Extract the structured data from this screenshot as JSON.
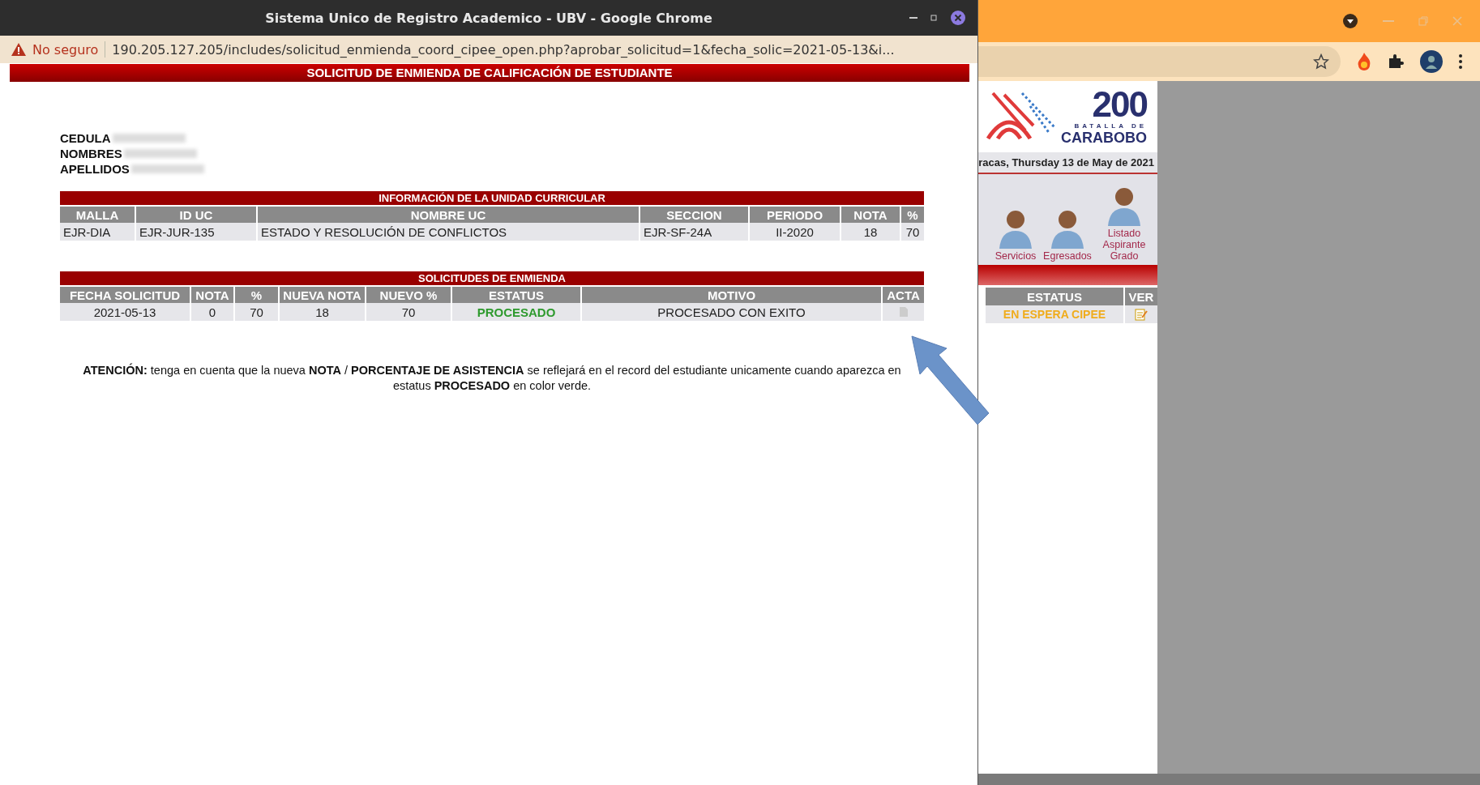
{
  "popup": {
    "title": "Sistema Unico de Registro Academico - UBV - Google Chrome",
    "security_label": "No seguro",
    "url": "190.205.127.205/includes/solicitud_enmienda_coord_cipee_open.php?aprobar_solicitud=1&fecha_solic=2021-05-13&i...",
    "page_title": "SOLICITUD DE ENMIENDA DE CALIFICACIÓN DE ESTUDIANTE"
  },
  "student": [
    {
      "label": "CEDULA"
    },
    {
      "label": "NOMBRES"
    },
    {
      "label": "APELLIDOS"
    }
  ],
  "course_table": {
    "title": "INFORMACIÓN DE LA UNIDAD CURRICULAR",
    "columns": [
      "MALLA",
      "ID UC",
      "NOMBRE UC",
      "SECCION",
      "PERIODO",
      "NOTA",
      "%"
    ],
    "rows": [
      [
        "EJR-DIA",
        "EJR-JUR-135",
        "ESTADO Y RESOLUCIÓN DE CONFLICTOS",
        "EJR-SF-24A",
        "II-2020",
        "18",
        "70"
      ]
    ]
  },
  "requests_table": {
    "title": "SOLICITUDES DE ENMIENDA",
    "columns": [
      "FECHA SOLICITUD",
      "NOTA",
      "%",
      "NUEVA NOTA",
      "NUEVO %",
      "ESTATUS",
      "MOTIVO",
      "ACTA"
    ],
    "rows": [
      {
        "fecha": "2021-05-13",
        "nota": "0",
        "porcentaje": "70",
        "nueva_nota": "18",
        "nuevo_porcentaje": "70",
        "status": "PROCESADO",
        "color": "#2e9a2e",
        "motivo": "PROCESADO CON EXITO"
      }
    ]
  },
  "notice": "**ATENCIÓN:** tenga en cuenta que la nueva **NOTA** / **PORCENTAJE DE ASISTENCIA** se reflejará en el record del estudiante unicamente cuando aparezca en estatus **PROCESADO** en color verde.",
  "background_browser": {
    "logo": {
      "number": "200",
      "line1": "BATALLA DE",
      "line2": "CARABOBO"
    },
    "date": "racas, Thursday 13 de May de 2021",
    "menu_items": [
      {
        "label": "Servicios"
      },
      {
        "label": "Egresados"
      },
      {
        "label": "Listado Aspirante Grado"
      }
    ],
    "table": {
      "columns": [
        "ESTATUS",
        "VER"
      ],
      "rows": [
        {
          "status": "EN ESPERA CIPEE",
          "color": "#f0ac1c"
        }
      ]
    }
  }
}
